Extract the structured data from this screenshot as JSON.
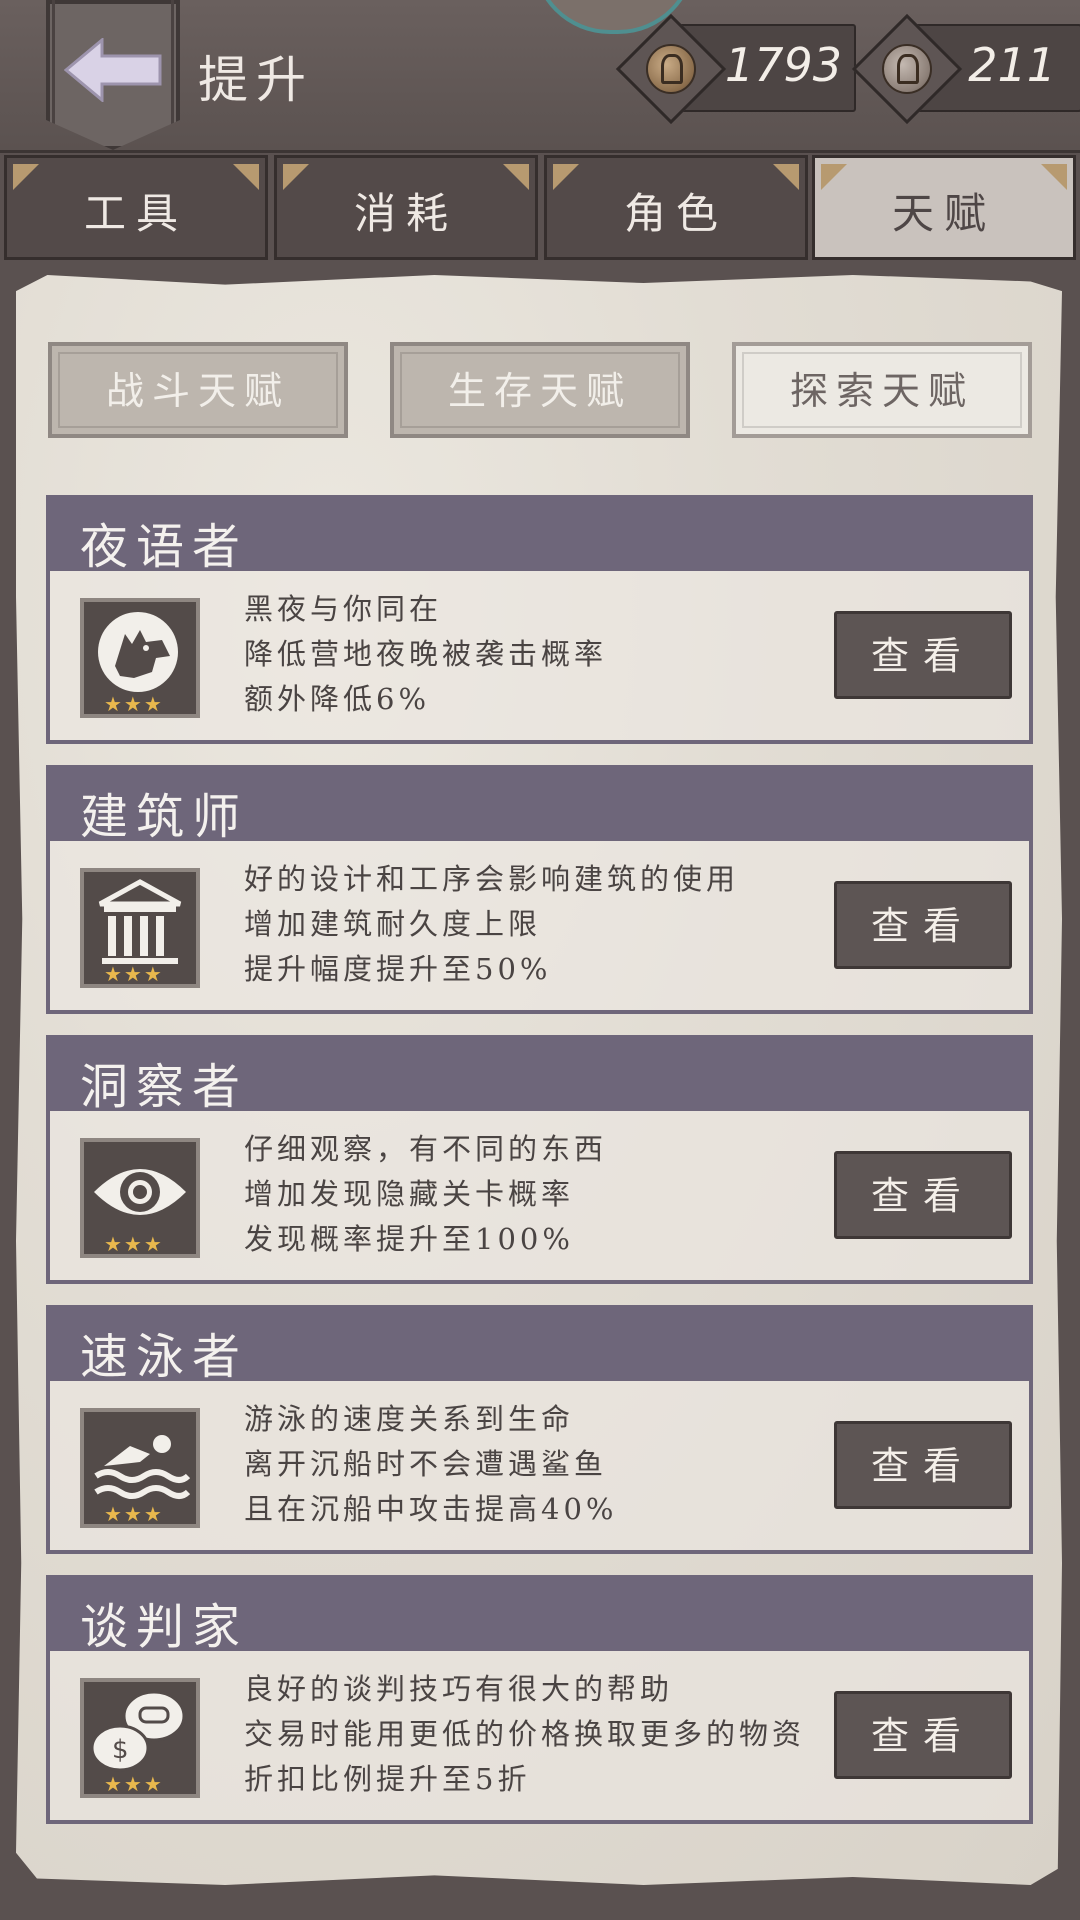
{
  "header": {
    "title": "提升",
    "currencies": [
      {
        "icon": "horse-coin-icon",
        "amount": "1793"
      },
      {
        "icon": "horse-token-icon",
        "amount": "211"
      }
    ]
  },
  "tabs": [
    {
      "label": "工具",
      "active": false
    },
    {
      "label": "消耗",
      "active": false
    },
    {
      "label": "角色",
      "active": false
    },
    {
      "label": "天赋",
      "active": true
    }
  ],
  "subtabs": [
    {
      "label": "战斗天赋",
      "active": false
    },
    {
      "label": "生存天赋",
      "active": false
    },
    {
      "label": "探索天赋",
      "active": true
    }
  ],
  "talents": [
    {
      "name": "夜语者",
      "icon": "wolf-icon",
      "stars": "★★★",
      "lines": [
        "黑夜与你同在",
        "降低营地夜晚被袭击概率",
        "额外降低6%"
      ],
      "button": "查看"
    },
    {
      "name": "建筑师",
      "icon": "building-icon",
      "stars": "★★★",
      "lines": [
        "好的设计和工序会影响建筑的使用",
        "增加建筑耐久度上限",
        "提升幅度提升至50%"
      ],
      "button": "查看"
    },
    {
      "name": "洞察者",
      "icon": "eye-icon",
      "stars": "★★★",
      "lines": [
        "仔细观察，有不同的东西",
        "增加发现隐藏关卡概率",
        "发现概率提升至100%"
      ],
      "button": "查看"
    },
    {
      "name": "速泳者",
      "icon": "swimmer-icon",
      "stars": "★★★",
      "lines": [
        "游泳的速度关系到生命",
        "离开沉船时不会遭遇鲨鱼",
        "且在沉船中攻击提高40%"
      ],
      "button": "查看"
    },
    {
      "name": "谈判家",
      "icon": "negotiation-icon",
      "stars": "★★★",
      "lines": [
        "良好的谈判技巧有很大的帮助",
        "交易时能用更低的价格换取更多的物资",
        "折扣比例提升至5折"
      ],
      "button": "查看"
    }
  ]
}
